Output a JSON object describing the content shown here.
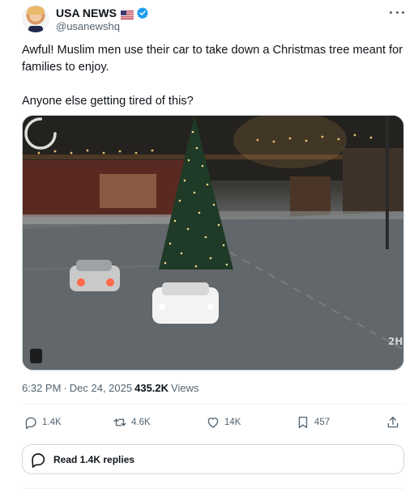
{
  "author": {
    "display_name": "USA NEWS",
    "handle": "@usanewshq",
    "flag_icon": "us-flag-icon",
    "verified_icon": "verified-badge-icon",
    "verified_color": "#1d9bf0"
  },
  "tweet": {
    "text": "Awful! Muslim men use their car to take down a Christmas tree meant for families to enjoy.\n\nAnyone else getting tired of this?"
  },
  "media": {
    "type": "video",
    "watermark": "2H",
    "loading_icon": "loading-spinner-icon"
  },
  "meta": {
    "time": "6:32 PM",
    "separator": "·",
    "date": "Dec 24, 2025",
    "views_count": "435.2K",
    "views_label": "Views"
  },
  "actions": {
    "replies": "1.4K",
    "reposts": "4.6K",
    "likes": "14K",
    "bookmarks": "457"
  },
  "read_replies_label": "Read 1.4K replies",
  "colors": {
    "text_primary": "#0f1419",
    "text_secondary": "#536471",
    "border": "#cfd9de"
  }
}
